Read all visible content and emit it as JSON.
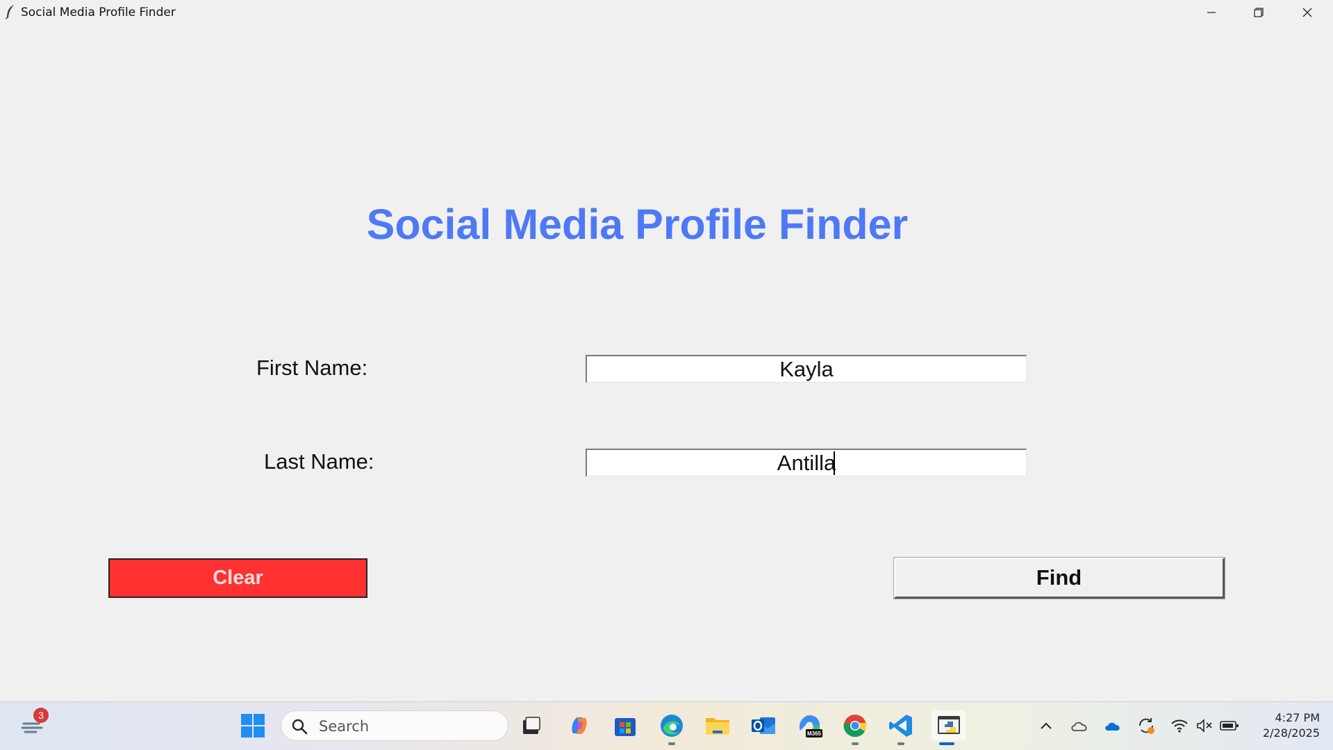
{
  "window": {
    "title": "Social Media Profile Finder"
  },
  "app": {
    "heading": "Social Media Profile Finder",
    "first_name_label": "First Name:",
    "last_name_label": "Last Name:",
    "first_name_value": "Kayla",
    "last_name_value": "Antilla",
    "clear_label": "Clear",
    "find_label": "Find",
    "colors": {
      "heading": "#4e79f5",
      "clear_bg": "#ff3131"
    }
  },
  "taskbar": {
    "widgets_badge": "3",
    "search_placeholder": "Search",
    "apps": [
      "start-icon",
      "task-view-icon",
      "copilot-icon",
      "store-icon",
      "edge-icon",
      "file-explorer-icon",
      "outlook-icon",
      "m365-icon",
      "chrome-icon",
      "vscode-icon",
      "python-idle-icon"
    ],
    "m365_text": "M365",
    "time": "4:27 PM",
    "date": "2/28/2025"
  }
}
